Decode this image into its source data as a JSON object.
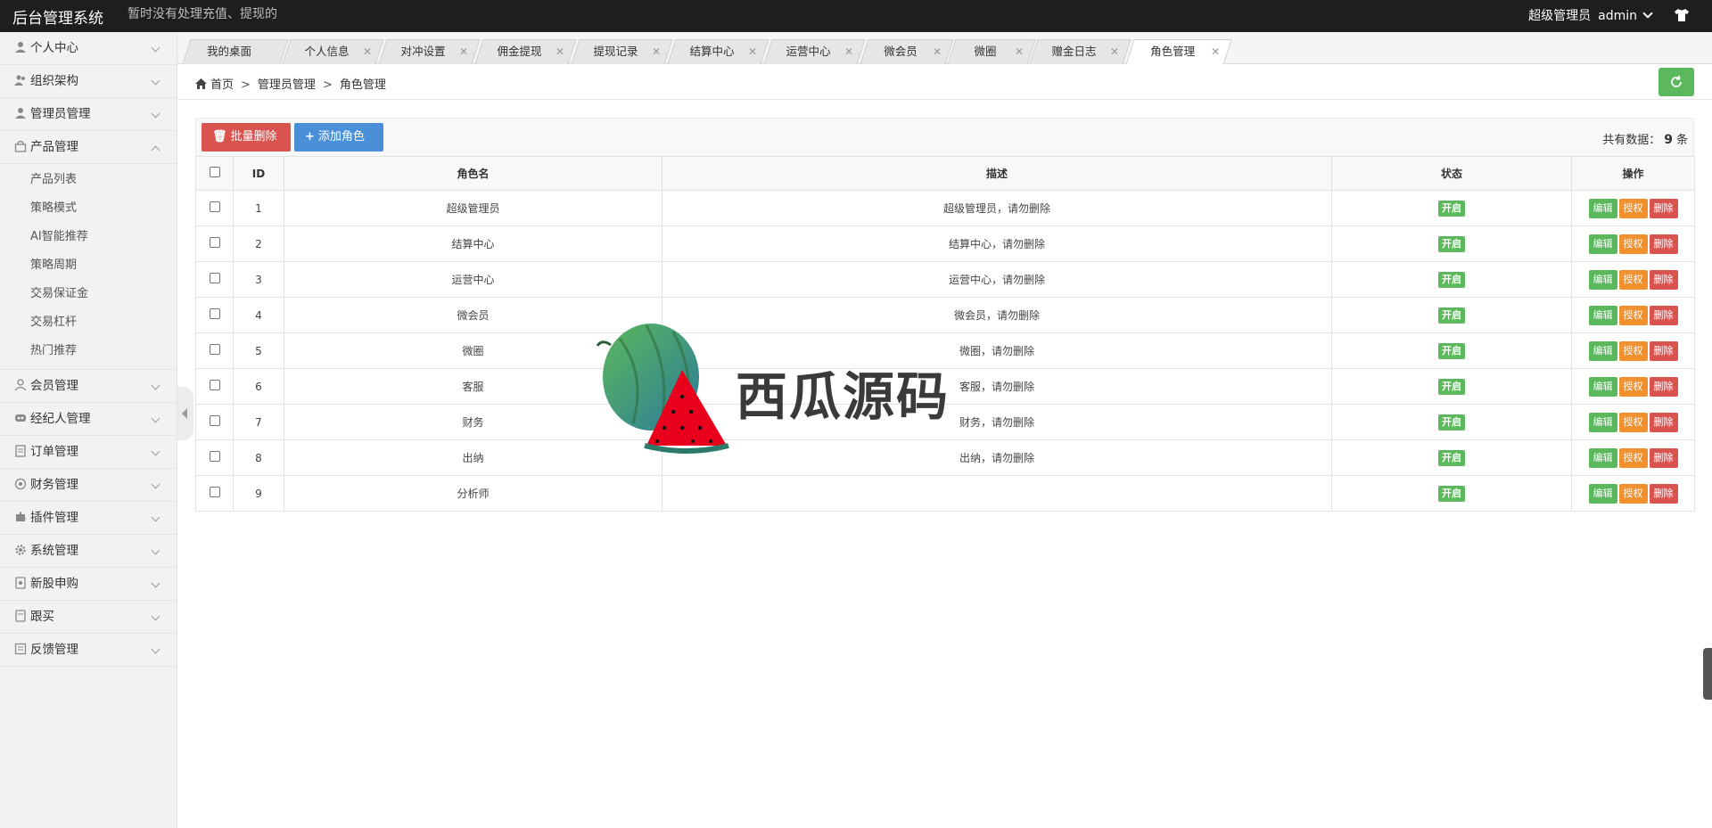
{
  "header": {
    "brand": "后台管理系统",
    "notice": "暂时没有处理充值、提现的",
    "role": "超级管理员",
    "username": "admin"
  },
  "sidebar": {
    "items": [
      {
        "label": "个人中心",
        "icon": "user-icon"
      },
      {
        "label": "组织架构",
        "icon": "org-icon"
      },
      {
        "label": "管理员管理",
        "icon": "admin-icon"
      },
      {
        "label": "产品管理",
        "icon": "product-icon"
      },
      {
        "label": "会员管理",
        "icon": "member-icon"
      },
      {
        "label": "经纪人管理",
        "icon": "broker-icon"
      },
      {
        "label": "订单管理",
        "icon": "order-icon"
      },
      {
        "label": "财务管理",
        "icon": "finance-icon"
      },
      {
        "label": "插件管理",
        "icon": "plugin-icon"
      },
      {
        "label": "系统管理",
        "icon": "gear-icon"
      },
      {
        "label": "新股申购",
        "icon": "ipo-icon"
      },
      {
        "label": "跟买",
        "icon": "follow-icon"
      },
      {
        "label": "反馈管理",
        "icon": "feedback-icon"
      }
    ],
    "product_sub": [
      "产品列表",
      "策略模式",
      "AI智能推荐",
      "策略周期",
      "交易保证金",
      "交易杠杆",
      "热门推荐"
    ]
  },
  "tabs": [
    "我的桌面",
    "个人信息",
    "对冲设置",
    "佣金提现",
    "提现记录",
    "结算中心",
    "运营中心",
    "微会员",
    "微圈",
    "赠金日志",
    "角色管理"
  ],
  "breadcrumb": {
    "home": "首页",
    "level1": "管理员管理",
    "level2": "角色管理"
  },
  "toolbar": {
    "batch_delete": "批量删除",
    "add_role": "添加角色",
    "total_prefix": "共有数据：",
    "total_count": "9",
    "total_suffix": "条"
  },
  "table": {
    "headers": {
      "id": "ID",
      "name": "角色名",
      "desc": "描述",
      "status": "状态",
      "ops": "操作"
    },
    "rows": [
      {
        "id": "1",
        "name": "超级管理员",
        "desc": "超级管理员，请勿删除",
        "status": "开启"
      },
      {
        "id": "2",
        "name": "结算中心",
        "desc": "结算中心，请勿删除",
        "status": "开启"
      },
      {
        "id": "3",
        "name": "运营中心",
        "desc": "运营中心，请勿删除",
        "status": "开启"
      },
      {
        "id": "4",
        "name": "微会员",
        "desc": "微会员，请勿删除",
        "status": "开启"
      },
      {
        "id": "5",
        "name": "微圈",
        "desc": "微圈，请勿删除",
        "status": "开启"
      },
      {
        "id": "6",
        "name": "客服",
        "desc": "客服，请勿删除",
        "status": "开启"
      },
      {
        "id": "7",
        "name": "财务",
        "desc": "财务，请勿删除",
        "status": "开启"
      },
      {
        "id": "8",
        "name": "出纳",
        "desc": "出纳，请勿删除",
        "status": "开启"
      },
      {
        "id": "9",
        "name": "分析师",
        "desc": "",
        "status": "开启"
      }
    ],
    "op_labels": {
      "edit": "编辑",
      "auth": "授权",
      "del": "删除"
    }
  },
  "watermark": {
    "text": "西瓜源码"
  },
  "colors": {
    "header_bg": "#1e1e1e",
    "success": "#5cb85c",
    "warning": "#f0902f",
    "danger": "#d9534f",
    "primary": "#4a90d9"
  }
}
